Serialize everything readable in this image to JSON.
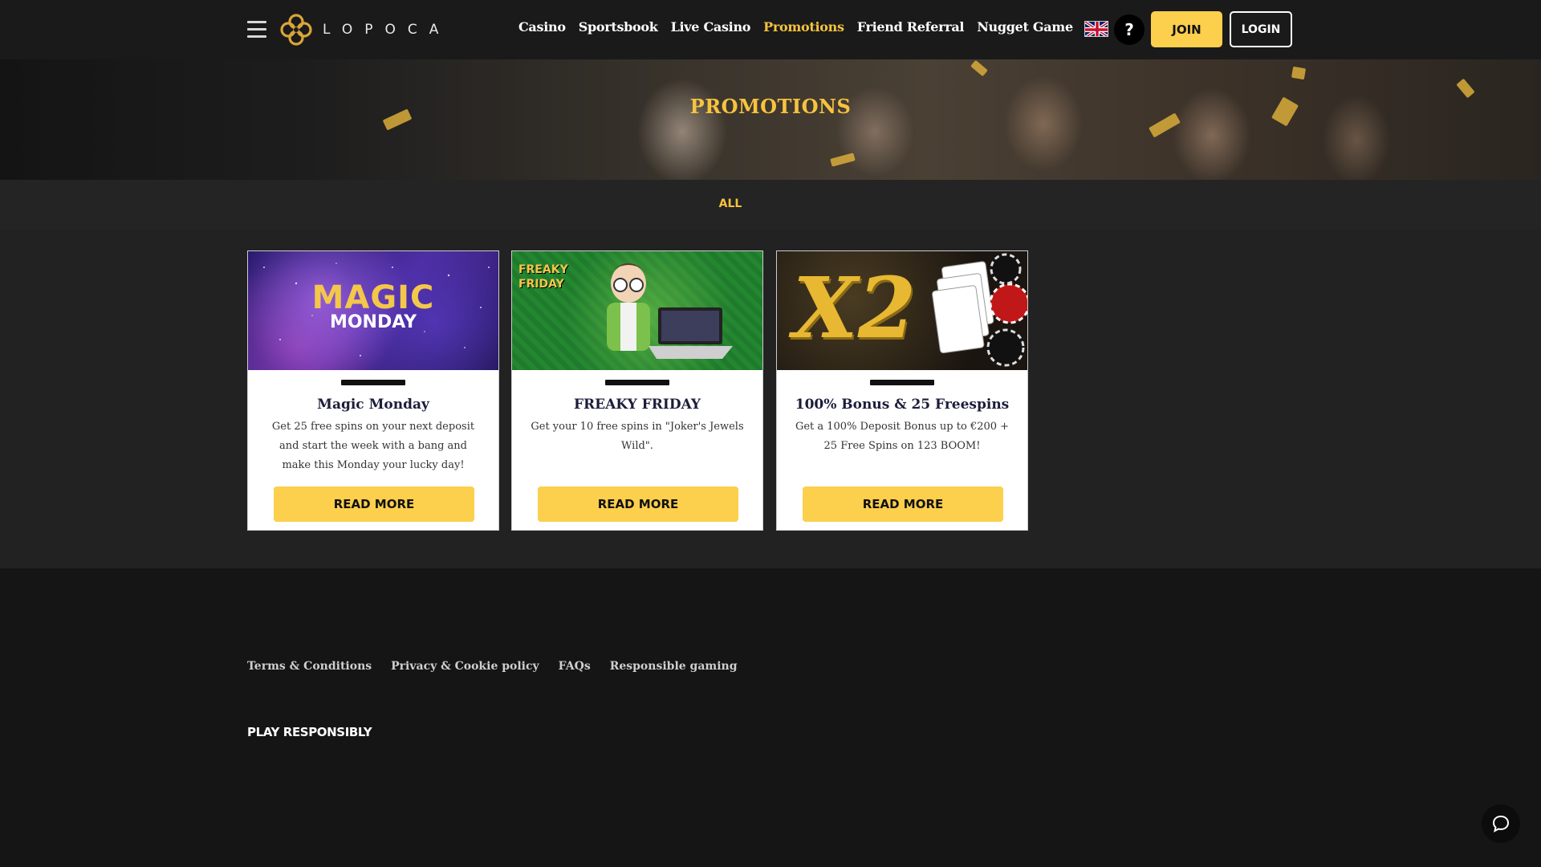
{
  "header": {
    "brand": "LOPOCA",
    "nav": [
      {
        "label": "Casino",
        "active": false
      },
      {
        "label": "Sportsbook",
        "active": false
      },
      {
        "label": "Live Casino",
        "active": false
      },
      {
        "label": "Promotions",
        "active": true
      },
      {
        "label": "Friend Referral",
        "active": false
      },
      {
        "label": "Nugget Game",
        "active": false
      }
    ],
    "help_label": "?",
    "join_label": "JOIN",
    "login_label": "LOGIN",
    "language_icon": "uk-flag-icon"
  },
  "hero": {
    "title": "PROMOTIONS"
  },
  "filters": {
    "active": "ALL"
  },
  "promotions": [
    {
      "image_title_line1": "MAGIC",
      "image_title_line2": "MONDAY",
      "title": "Magic Monday",
      "description": "Get 25 free spins on your next deposit and start the week with a bang and make this Monday your lucky day!",
      "button": "READ MORE"
    },
    {
      "image_title_line1": "FREAKY",
      "image_title_line2": "FRIDAY",
      "title": "FREAKY FRIDAY",
      "description": "Get your 10 free spins in \"Joker's Jewels Wild\".",
      "button": "READ MORE"
    },
    {
      "image_title_line1": "X2",
      "image_title_line2": "",
      "title": "100% Bonus & 25 Freespins",
      "description": "Get a 100% Deposit Bonus up to €200 + 25 Free Spins on 123 BOOM!",
      "button": "READ MORE"
    }
  ],
  "footer": {
    "links": [
      "Terms & Conditions",
      "Privacy & Cookie policy",
      "FAQs",
      "Responsible gaming"
    ],
    "play_responsibly": "PLAY RESPONSIBLY"
  },
  "colors": {
    "accent": "#f7c33f",
    "button": "#fccf4d",
    "header_bg": "#1a1a1a",
    "content_bg": "#222222"
  }
}
